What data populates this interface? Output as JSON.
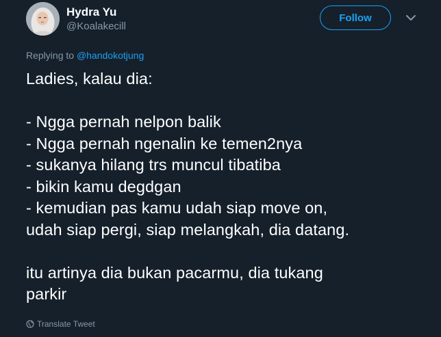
{
  "user": {
    "name": "Hydra Yu",
    "handle": "@Koalakecill"
  },
  "follow_label": "Follow",
  "reply": {
    "prefix": "Replying to ",
    "mention": "@handokotjung"
  },
  "tweet_lines": [
    "Ladies, kalau dia:",
    "",
    "- Ngga pernah nelpon balik",
    "- Ngga pernah ngenalin ke temen2nya",
    "- sukanya hilang trs muncul tibatiba",
    "- bikin kamu degdgan",
    "- kemudian pas kamu udah siap move on,",
    "udah siap pergi, siap melangkah, dia datang.",
    "",
    "itu artinya dia bukan pacarmu, dia tukang",
    "parkir"
  ],
  "translate_label": "Translate Tweet",
  "colors": {
    "background": "#15202b",
    "accent": "#1da1f2",
    "secondary_text": "#8899a6",
    "primary_text": "#ffffff"
  },
  "icons": {
    "avatar": "avatar",
    "more": "chevron-down-icon",
    "translate": "globe-icon"
  }
}
